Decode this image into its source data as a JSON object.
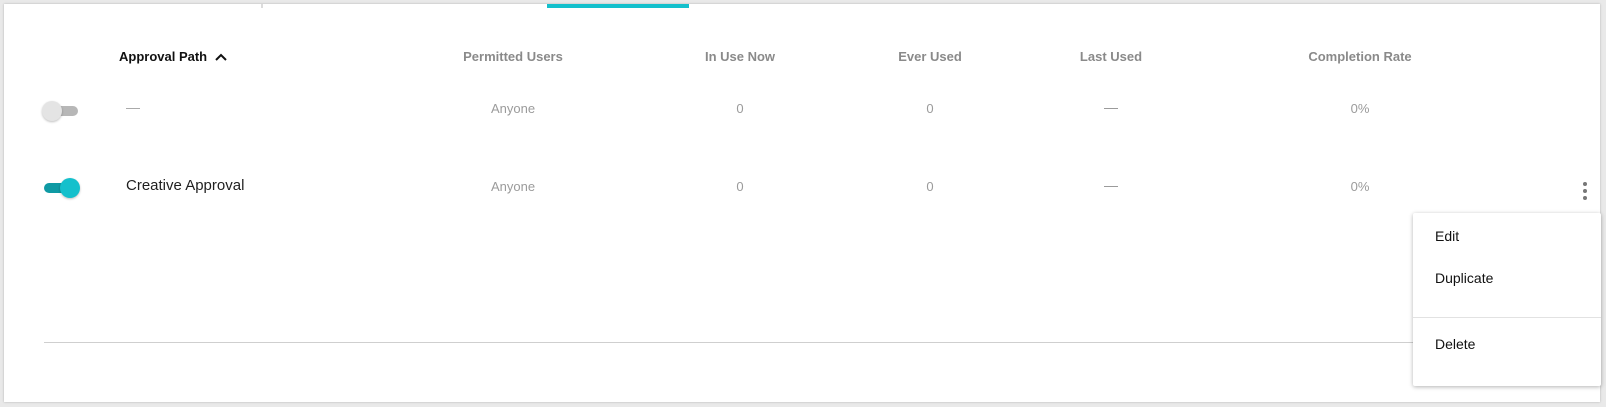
{
  "table": {
    "headers": {
      "approval_path": "Approval Path",
      "permitted_users": "Permitted Users",
      "in_use_now": "In Use Now",
      "ever_used": "Ever Used",
      "last_used": "Last Used",
      "completion_rate": "Completion Rate"
    },
    "sort": {
      "column": "approval_path",
      "direction": "ascending",
      "icon": "chevron-up-icon"
    },
    "rows": [
      {
        "enabled": false,
        "name": "",
        "permitted_users": "Anyone",
        "in_use_now": "0",
        "ever_used": "0",
        "last_used": "",
        "completion_rate": "0%"
      },
      {
        "enabled": true,
        "name": "Creative Approval",
        "permitted_users": "Anyone",
        "in_use_now": "0",
        "ever_used": "0",
        "last_used": "",
        "completion_rate": "0%"
      }
    ]
  },
  "context_menu": {
    "items": [
      "Edit",
      "Duplicate",
      "Delete"
    ]
  },
  "colors": {
    "accent": "#14c0cc",
    "accent_dark": "#0f9aa4"
  },
  "icons": [
    "toggle-switch-icon",
    "chevron-up-icon",
    "more-vertical-icon"
  ]
}
